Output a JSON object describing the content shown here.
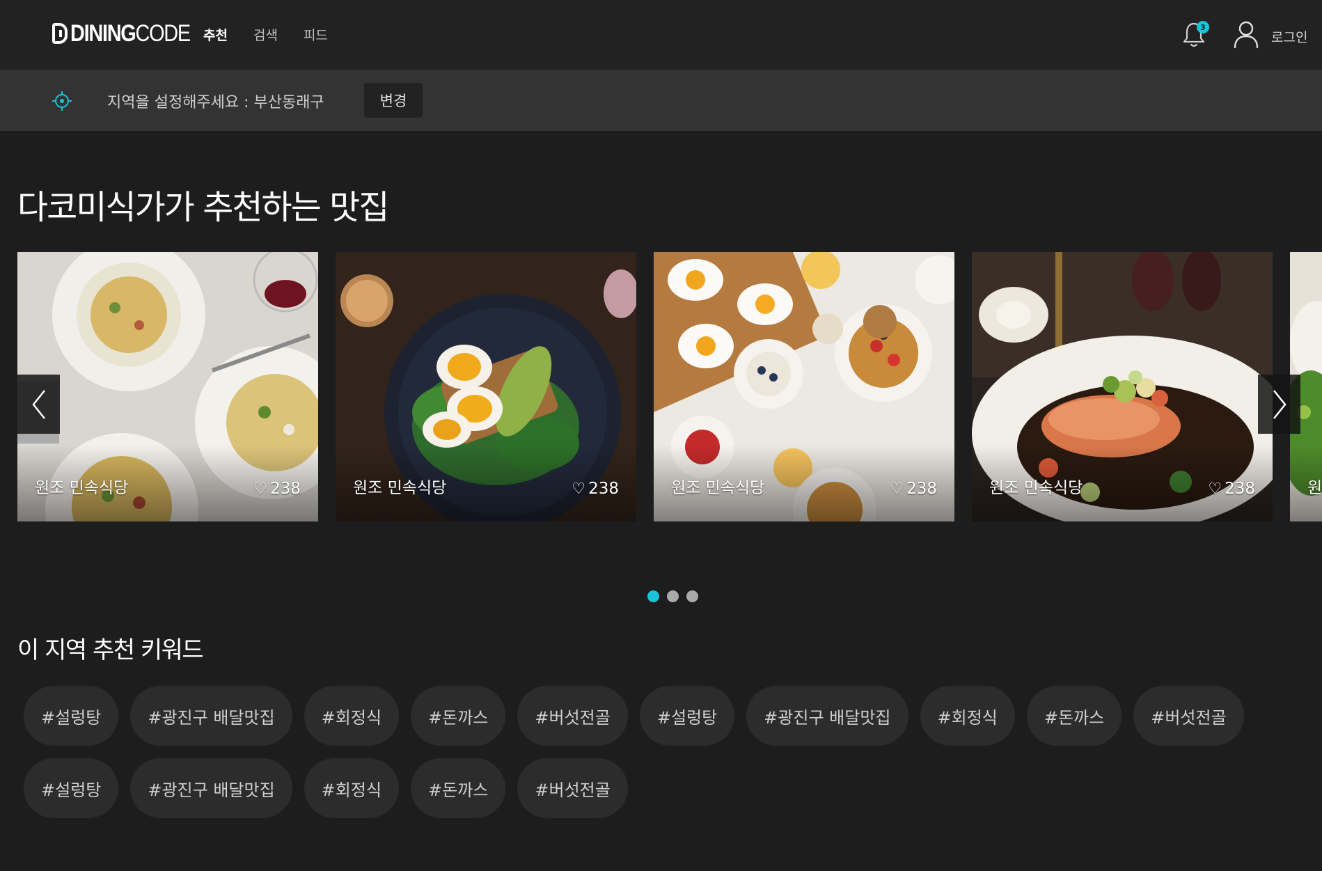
{
  "header": {
    "logo_text_bold": "DINING",
    "logo_text_thin": "CODE",
    "nav": [
      {
        "label": "추천",
        "active": true
      },
      {
        "label": "검색",
        "active": false
      },
      {
        "label": "피드",
        "active": false
      }
    ],
    "notification_count": "3",
    "login_label": "로그인",
    "accent_color": "#19c4d6"
  },
  "location": {
    "prompt": "지역을 설정해주세요 :  부산동래구",
    "change_label": "변경"
  },
  "recommend": {
    "title": "다코미식가가 추천하는 맛집",
    "cards": [
      {
        "name": "원조 민속식당",
        "likes": "238",
        "image": "pasta-plates-photo"
      },
      {
        "name": "원조 민속식당",
        "likes": "238",
        "image": "egg-avocado-toast-photo"
      },
      {
        "name": "원조 민속식당",
        "likes": "238",
        "image": "breakfast-waffles-table-photo"
      },
      {
        "name": "원조 민속식당",
        "likes": "238",
        "image": "salmon-dish-photo"
      },
      {
        "name": "원",
        "likes": "",
        "image": "partial-food-photo"
      }
    ],
    "page_count": 3,
    "active_page": 1
  },
  "keywords": {
    "title": "이 지역 추천 키워드",
    "row1": [
      "#설렁탕",
      "#광진구 배달맛집",
      "#회정식",
      "#돈까스",
      "#버섯전골",
      "#설렁탕",
      "#광진구 배달맛집",
      "#회정식",
      "#돈까스",
      "#버섯전골"
    ],
    "row2": [
      "#설렁탕",
      "#광진구 배달맛집",
      "#회정식",
      "#돈까스",
      "#버섯전골"
    ]
  }
}
